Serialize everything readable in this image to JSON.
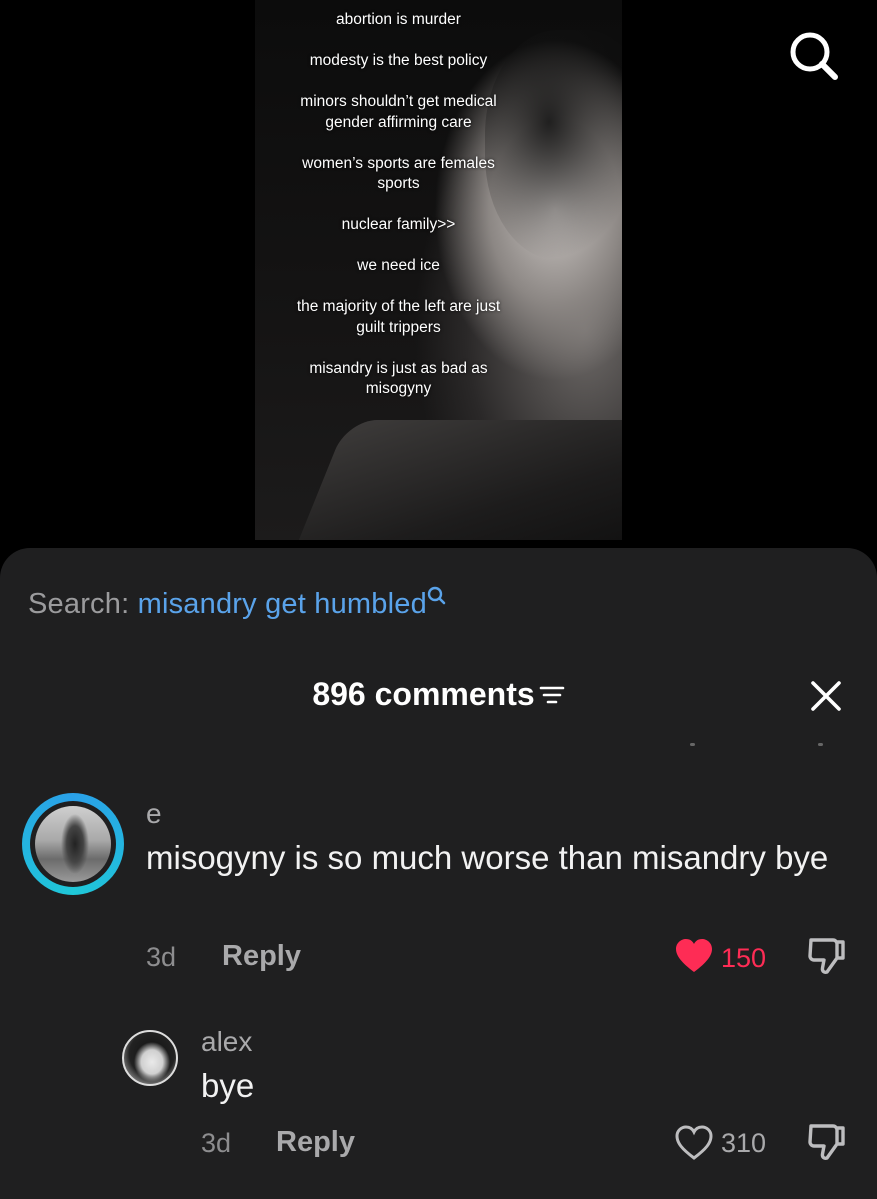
{
  "video": {
    "overlay_lines": [
      "abortion is murder",
      "modesty is the best policy",
      "minors shouldn’t get medical gender affirming care",
      "women’s sports are females sports",
      "nuclear family>>",
      "we need ice",
      "the majority of the left are just guilt trippers",
      "misandry is just as bad as misogyny"
    ]
  },
  "search": {
    "prefix": "Search: ",
    "term": "misandry get humbled"
  },
  "comments_header": {
    "count_label": "896 comments"
  },
  "comments": [
    {
      "username": "e",
      "text": "misogyny is so much worse than misandry bye",
      "time": "3d",
      "reply_label": "Reply",
      "likes": "150",
      "liked": true
    },
    {
      "username": "alex",
      "text": "bye",
      "time": "3d",
      "reply_label": "Reply",
      "likes": "310",
      "liked": false
    }
  ],
  "colors": {
    "sheet_bg": "#1f1f20",
    "search_term": "#5aa3ea",
    "like_red": "#fe2c55",
    "avatar_ring": "#2aa0e8"
  },
  "icons": {
    "top_search": "search-icon",
    "search_suffix": "search-icon",
    "sort": "sort-icon",
    "close": "close-icon",
    "like_filled": "heart-filled-icon",
    "like_outline": "heart-outline-icon",
    "dislike": "thumbs-down-icon"
  }
}
